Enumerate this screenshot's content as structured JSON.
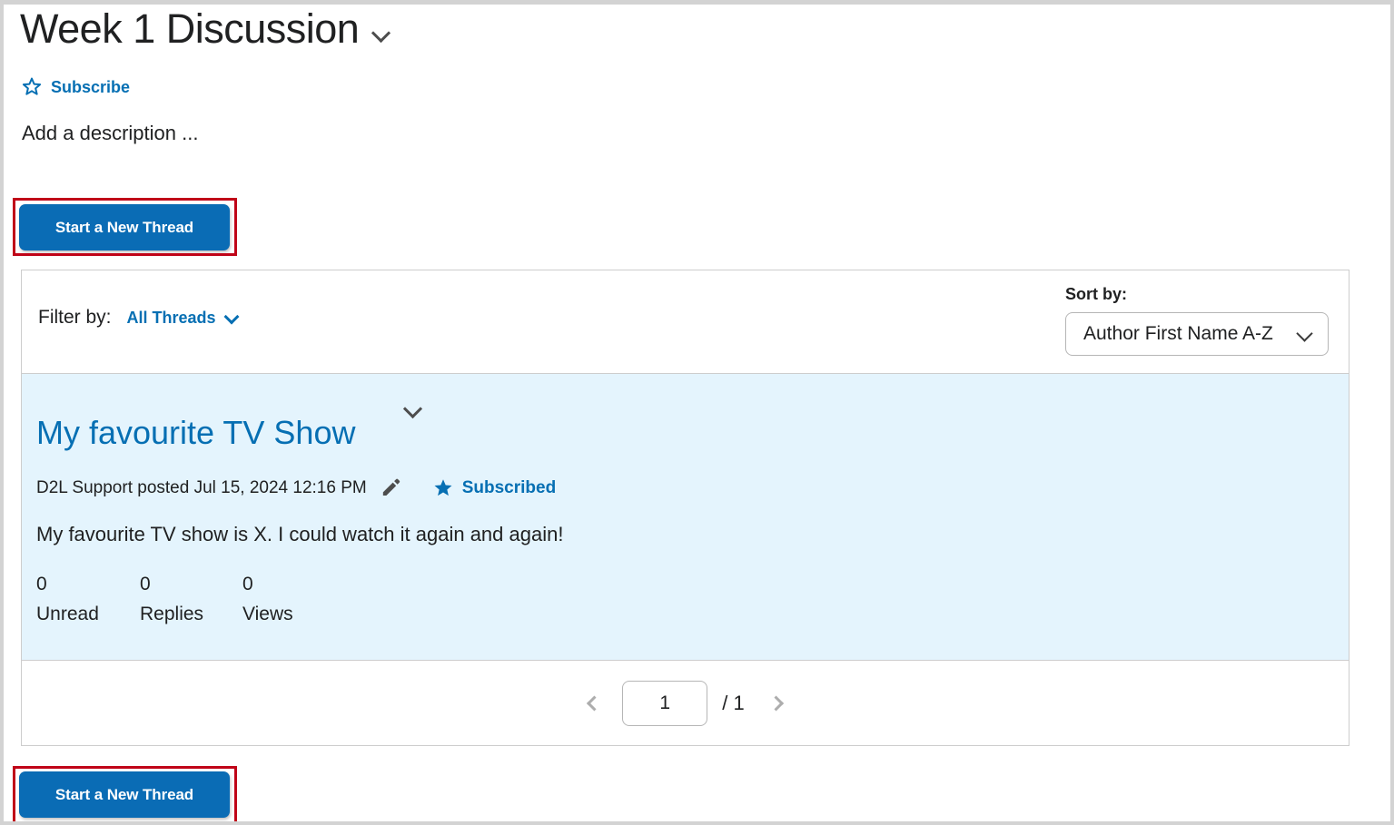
{
  "header": {
    "title": "Week 1 Discussion",
    "title_chevron_icon": "chevron-down-icon",
    "subscribe_label": "Subscribe",
    "subscribe_icon": "star-outline-icon",
    "description": "Add a description ..."
  },
  "actions": {
    "start_new_thread_label": "Start a New Thread"
  },
  "filter_bar": {
    "filter_label": "Filter by:",
    "filter_value": "All Threads",
    "filter_chevron_icon": "chevron-down-icon",
    "sort_label": "Sort by:",
    "sort_value": "Author First Name A-Z",
    "sort_chevron_icon": "chevron-down-icon"
  },
  "threads": [
    {
      "chevron_icon": "chevron-down-icon",
      "title": "My favourite TV Show",
      "meta": "D2L Support posted Jul 15, 2024 12:16 PM",
      "edit_icon": "pencil-icon",
      "subscribed_icon": "star-filled-icon",
      "subscribed_label": "Subscribed",
      "body": "My favourite TV show is X. I could watch it again and again!",
      "stats": [
        {
          "value": "0",
          "label": "Unread"
        },
        {
          "value": "0",
          "label": "Replies"
        },
        {
          "value": "0",
          "label": "Views"
        }
      ]
    }
  ],
  "pagination": {
    "prev_icon": "chevron-left-icon",
    "next_icon": "chevron-right-icon",
    "current_page": "1",
    "total_pages": "/ 1"
  },
  "colors": {
    "primary_blue": "#0a6cb5",
    "link_blue": "#066fb3",
    "thread_highlight": "#e4f4fd",
    "annotation_red": "#c00418",
    "border_gray": "#cdcdcd"
  }
}
